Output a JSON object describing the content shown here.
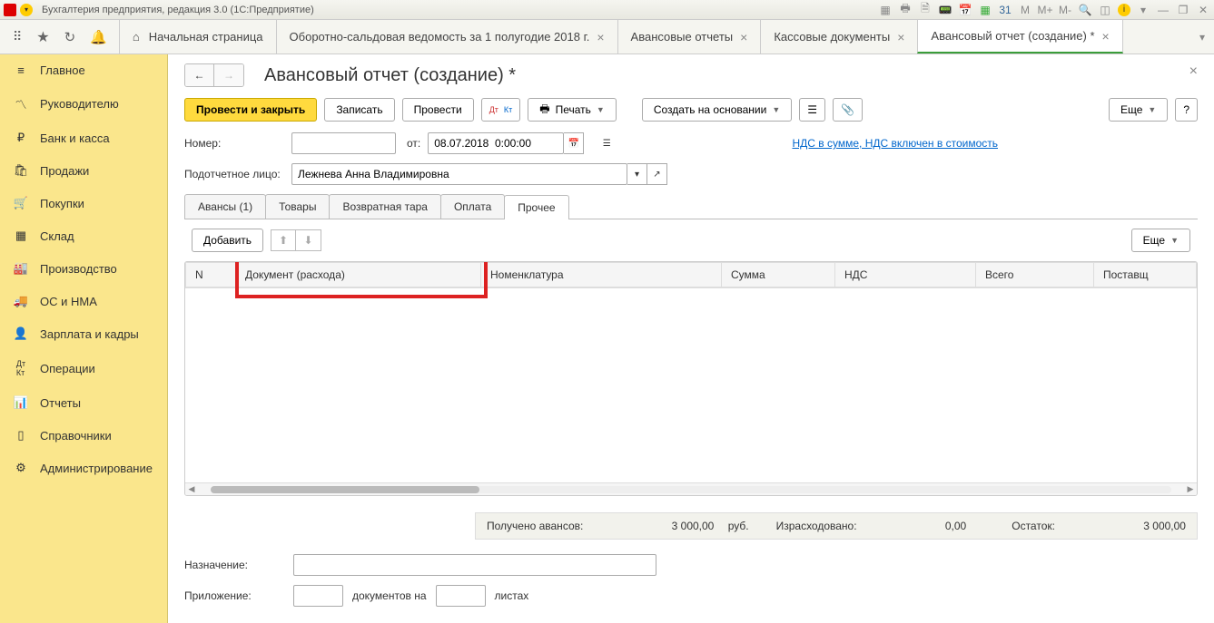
{
  "titlebar": {
    "title": "Бухгалтерия предприятия, редакция 3.0  (1С:Предприятие)",
    "m_labels": [
      "M",
      "M+",
      "M-"
    ]
  },
  "tabs": {
    "home": "Начальная страница",
    "items": [
      "Оборотно-сальдовая ведомость за 1 полугодие 2018 г.",
      "Авансовые отчеты",
      "Кассовые документы",
      "Авансовый отчет (создание) *"
    ],
    "active_index": 3
  },
  "sidebar": {
    "items": [
      {
        "label": "Главное",
        "icon": "menu"
      },
      {
        "label": "Руководителю",
        "icon": "chart"
      },
      {
        "label": "Банк и касса",
        "icon": "ruble"
      },
      {
        "label": "Продажи",
        "icon": "bag"
      },
      {
        "label": "Покупки",
        "icon": "cart"
      },
      {
        "label": "Склад",
        "icon": "boxes"
      },
      {
        "label": "Производство",
        "icon": "factory"
      },
      {
        "label": "ОС и НМА",
        "icon": "truck"
      },
      {
        "label": "Зарплата и кадры",
        "icon": "person"
      },
      {
        "label": "Операции",
        "icon": "dtkt"
      },
      {
        "label": "Отчеты",
        "icon": "bars"
      },
      {
        "label": "Справочники",
        "icon": "book"
      },
      {
        "label": "Администрирование",
        "icon": "gear"
      }
    ]
  },
  "page": {
    "title": "Авансовый отчет (создание) *"
  },
  "toolbar": {
    "post_close": "Провести и закрыть",
    "write": "Записать",
    "post": "Провести",
    "print": "Печать",
    "create_based": "Создать на основании",
    "more": "Еще",
    "help": "?"
  },
  "form": {
    "number_label": "Номер:",
    "number_value": "",
    "from_label": "от:",
    "date_value": "08.07.2018  0:00:00",
    "vat_link": "НДС в сумме, НДС включен в стоимость",
    "person_label": "Подотчетное лицо:",
    "person_value": "Лежнева Анна Владимировна"
  },
  "subtabs": {
    "items": [
      "Авансы (1)",
      "Товары",
      "Возвратная тара",
      "Оплата",
      "Прочее"
    ],
    "active_index": 4
  },
  "sub_toolbar": {
    "add": "Добавить",
    "more": "Еще"
  },
  "grid": {
    "columns": [
      "N",
      "Документ (расхода)",
      "Номенклатура",
      "Сумма",
      "НДС",
      "Всего",
      "Поставщ"
    ]
  },
  "summary": {
    "received_label": "Получено авансов:",
    "received_value": "3 000,00",
    "currency": "руб.",
    "spent_label": "Израсходовано:",
    "spent_value": "0,00",
    "balance_label": "Остаток:",
    "balance_value": "3 000,00"
  },
  "bottom": {
    "purpose_label": "Назначение:",
    "purpose_value": "",
    "attachment_label": "Приложение:",
    "docs_count": "",
    "docs_text": "документов на",
    "sheets_count": "",
    "sheets_text": "листах"
  }
}
